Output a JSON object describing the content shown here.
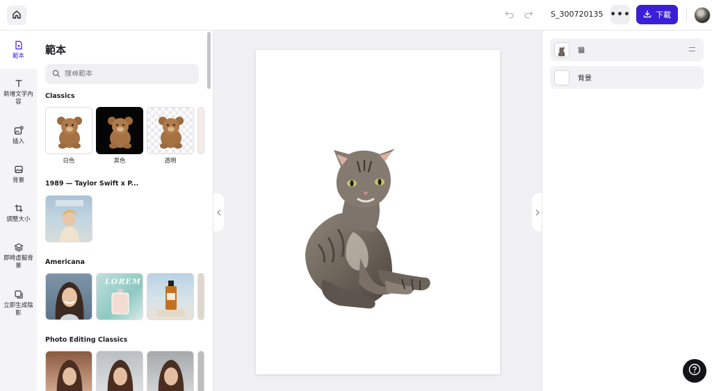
{
  "header": {
    "filename": "S_300720135",
    "more_label": "•••",
    "download_label": "下載"
  },
  "rail": {
    "items": [
      {
        "label": "範本"
      },
      {
        "label": "新增文字內容"
      },
      {
        "label": "插入"
      },
      {
        "label": "背景"
      },
      {
        "label": "調整大小"
      },
      {
        "label": "即時虛擬背景"
      },
      {
        "label": "立即生成陰影"
      }
    ]
  },
  "templates": {
    "title": "範本",
    "search_placeholder": "搜尋範本",
    "sections": [
      {
        "title": "Classics",
        "items": [
          "白色",
          "黑色",
          "透明"
        ]
      },
      {
        "title": "1989 — Taylor Swift x P..."
      },
      {
        "title": "Americana",
        "thumb_text": "LOREM"
      },
      {
        "title": "Photo Editing Classics"
      }
    ]
  },
  "layers": {
    "items": [
      {
        "label": "貓"
      },
      {
        "label": "背景"
      }
    ]
  },
  "colors": {
    "accent": "#3b1fd8",
    "help_button": "#141418"
  }
}
